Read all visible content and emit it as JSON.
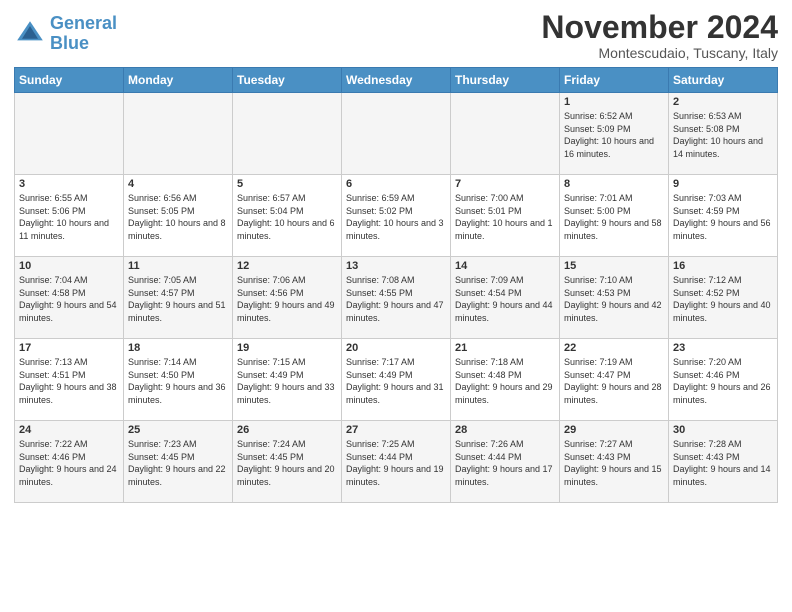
{
  "header": {
    "logo_line1": "General",
    "logo_line2": "Blue",
    "month_title": "November 2024",
    "subtitle": "Montescudaio, Tuscany, Italy"
  },
  "weekdays": [
    "Sunday",
    "Monday",
    "Tuesday",
    "Wednesday",
    "Thursday",
    "Friday",
    "Saturday"
  ],
  "weeks": [
    [
      {
        "day": "",
        "info": ""
      },
      {
        "day": "",
        "info": ""
      },
      {
        "day": "",
        "info": ""
      },
      {
        "day": "",
        "info": ""
      },
      {
        "day": "",
        "info": ""
      },
      {
        "day": "1",
        "info": "Sunrise: 6:52 AM\nSunset: 5:09 PM\nDaylight: 10 hours and 16 minutes."
      },
      {
        "day": "2",
        "info": "Sunrise: 6:53 AM\nSunset: 5:08 PM\nDaylight: 10 hours and 14 minutes."
      }
    ],
    [
      {
        "day": "3",
        "info": "Sunrise: 6:55 AM\nSunset: 5:06 PM\nDaylight: 10 hours and 11 minutes."
      },
      {
        "day": "4",
        "info": "Sunrise: 6:56 AM\nSunset: 5:05 PM\nDaylight: 10 hours and 8 minutes."
      },
      {
        "day": "5",
        "info": "Sunrise: 6:57 AM\nSunset: 5:04 PM\nDaylight: 10 hours and 6 minutes."
      },
      {
        "day": "6",
        "info": "Sunrise: 6:59 AM\nSunset: 5:02 PM\nDaylight: 10 hours and 3 minutes."
      },
      {
        "day": "7",
        "info": "Sunrise: 7:00 AM\nSunset: 5:01 PM\nDaylight: 10 hours and 1 minute."
      },
      {
        "day": "8",
        "info": "Sunrise: 7:01 AM\nSunset: 5:00 PM\nDaylight: 9 hours and 58 minutes."
      },
      {
        "day": "9",
        "info": "Sunrise: 7:03 AM\nSunset: 4:59 PM\nDaylight: 9 hours and 56 minutes."
      }
    ],
    [
      {
        "day": "10",
        "info": "Sunrise: 7:04 AM\nSunset: 4:58 PM\nDaylight: 9 hours and 54 minutes."
      },
      {
        "day": "11",
        "info": "Sunrise: 7:05 AM\nSunset: 4:57 PM\nDaylight: 9 hours and 51 minutes."
      },
      {
        "day": "12",
        "info": "Sunrise: 7:06 AM\nSunset: 4:56 PM\nDaylight: 9 hours and 49 minutes."
      },
      {
        "day": "13",
        "info": "Sunrise: 7:08 AM\nSunset: 4:55 PM\nDaylight: 9 hours and 47 minutes."
      },
      {
        "day": "14",
        "info": "Sunrise: 7:09 AM\nSunset: 4:54 PM\nDaylight: 9 hours and 44 minutes."
      },
      {
        "day": "15",
        "info": "Sunrise: 7:10 AM\nSunset: 4:53 PM\nDaylight: 9 hours and 42 minutes."
      },
      {
        "day": "16",
        "info": "Sunrise: 7:12 AM\nSunset: 4:52 PM\nDaylight: 9 hours and 40 minutes."
      }
    ],
    [
      {
        "day": "17",
        "info": "Sunrise: 7:13 AM\nSunset: 4:51 PM\nDaylight: 9 hours and 38 minutes."
      },
      {
        "day": "18",
        "info": "Sunrise: 7:14 AM\nSunset: 4:50 PM\nDaylight: 9 hours and 36 minutes."
      },
      {
        "day": "19",
        "info": "Sunrise: 7:15 AM\nSunset: 4:49 PM\nDaylight: 9 hours and 33 minutes."
      },
      {
        "day": "20",
        "info": "Sunrise: 7:17 AM\nSunset: 4:49 PM\nDaylight: 9 hours and 31 minutes."
      },
      {
        "day": "21",
        "info": "Sunrise: 7:18 AM\nSunset: 4:48 PM\nDaylight: 9 hours and 29 minutes."
      },
      {
        "day": "22",
        "info": "Sunrise: 7:19 AM\nSunset: 4:47 PM\nDaylight: 9 hours and 28 minutes."
      },
      {
        "day": "23",
        "info": "Sunrise: 7:20 AM\nSunset: 4:46 PM\nDaylight: 9 hours and 26 minutes."
      }
    ],
    [
      {
        "day": "24",
        "info": "Sunrise: 7:22 AM\nSunset: 4:46 PM\nDaylight: 9 hours and 24 minutes."
      },
      {
        "day": "25",
        "info": "Sunrise: 7:23 AM\nSunset: 4:45 PM\nDaylight: 9 hours and 22 minutes."
      },
      {
        "day": "26",
        "info": "Sunrise: 7:24 AM\nSunset: 4:45 PM\nDaylight: 9 hours and 20 minutes."
      },
      {
        "day": "27",
        "info": "Sunrise: 7:25 AM\nSunset: 4:44 PM\nDaylight: 9 hours and 19 minutes."
      },
      {
        "day": "28",
        "info": "Sunrise: 7:26 AM\nSunset: 4:44 PM\nDaylight: 9 hours and 17 minutes."
      },
      {
        "day": "29",
        "info": "Sunrise: 7:27 AM\nSunset: 4:43 PM\nDaylight: 9 hours and 15 minutes."
      },
      {
        "day": "30",
        "info": "Sunrise: 7:28 AM\nSunset: 4:43 PM\nDaylight: 9 hours and 14 minutes."
      }
    ]
  ]
}
